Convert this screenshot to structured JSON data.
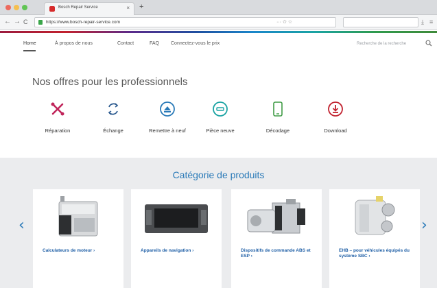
{
  "browser": {
    "tab_title": "Bosch Repair Service",
    "tab_close": "×",
    "new_tab": "+",
    "url": "https://www.bosch-repair-service.com",
    "url_extra": "··· ✩ ☆",
    "back": "←",
    "forward": "→",
    "reload": "C",
    "download": "⤓",
    "menu": "≡"
  },
  "nav": {
    "home": "Home",
    "about": "À propos de nous",
    "contact": "Contact",
    "faq": "FAQ",
    "login": "Connectez-vous le prix",
    "search_placeholder": "Recherche de la recherche"
  },
  "offers": {
    "title": "Nos offres pour les professionnels",
    "items": [
      {
        "label": "Réparation",
        "icon": "repair-icon",
        "color": "#c0245a"
      },
      {
        "label": "Échange",
        "icon": "exchange-icon",
        "color": "#2b5a8f"
      },
      {
        "label": "Remettre à neuf",
        "icon": "refurbish-icon",
        "color": "#2a7ab8"
      },
      {
        "label": "Pièce neuve",
        "icon": "new-part-icon",
        "color": "#1aa3a3"
      },
      {
        "label": "Décodage",
        "icon": "decoding-icon",
        "color": "#3f9b45"
      },
      {
        "label": "Download",
        "icon": "download-icon",
        "color": "#c1212e"
      }
    ]
  },
  "categories": {
    "title": "Catégorie de produits",
    "prev": "‹",
    "next": "›",
    "items": [
      {
        "label": "Calculateurs de moteur ›"
      },
      {
        "label": "Appareils de navigation ›"
      },
      {
        "label": "Dispositifs de commande ABS et ESP ›"
      },
      {
        "label": "EHB – pour véhicules équipés du système SBC ›"
      }
    ]
  },
  "colors": {
    "accent_blue": "#2a7ab8",
    "link_blue": "#1f5fa6"
  }
}
